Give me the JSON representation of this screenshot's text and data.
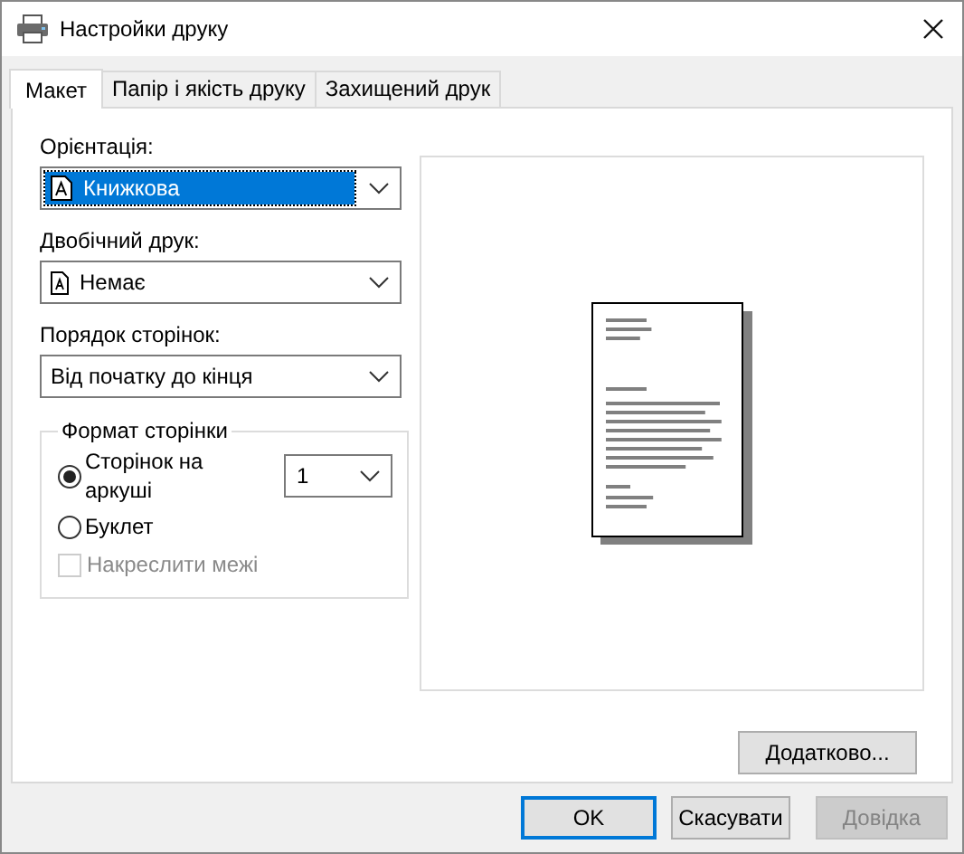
{
  "window": {
    "title": "Настройки друку"
  },
  "tabs": [
    {
      "label": "Макет",
      "selected": true
    },
    {
      "label": "Папір і якість друку",
      "selected": false
    },
    {
      "label": "Захищений друк",
      "selected": false
    }
  ],
  "fields": [
    {
      "label": "Орієнтація:",
      "value": "Книжкова",
      "kind": "orientation",
      "focused": true
    },
    {
      "label": "Двобічний друк:",
      "value": "Немає",
      "kind": "duplex",
      "focused": false
    },
    {
      "label": "Порядок сторінок:",
      "value": "Від початку до кінця",
      "kind": "order",
      "focused": false
    }
  ],
  "page_format": {
    "title": "Формат сторінки",
    "radios": [
      {
        "label": "Сторінок на аркуші",
        "selected": true
      },
      {
        "label": "Буклет",
        "selected": false
      }
    ],
    "pages_per_sheet": "1",
    "checkbox": {
      "label": "Накреслити межі",
      "checked": false,
      "disabled": true
    }
  },
  "advanced_button": "Додатково...",
  "buttons": [
    {
      "label": "OK",
      "default": true,
      "disabled": false
    },
    {
      "label": "Скасувати",
      "default": false,
      "disabled": false
    },
    {
      "label": "Довідка",
      "default": false,
      "disabled": true
    }
  ]
}
